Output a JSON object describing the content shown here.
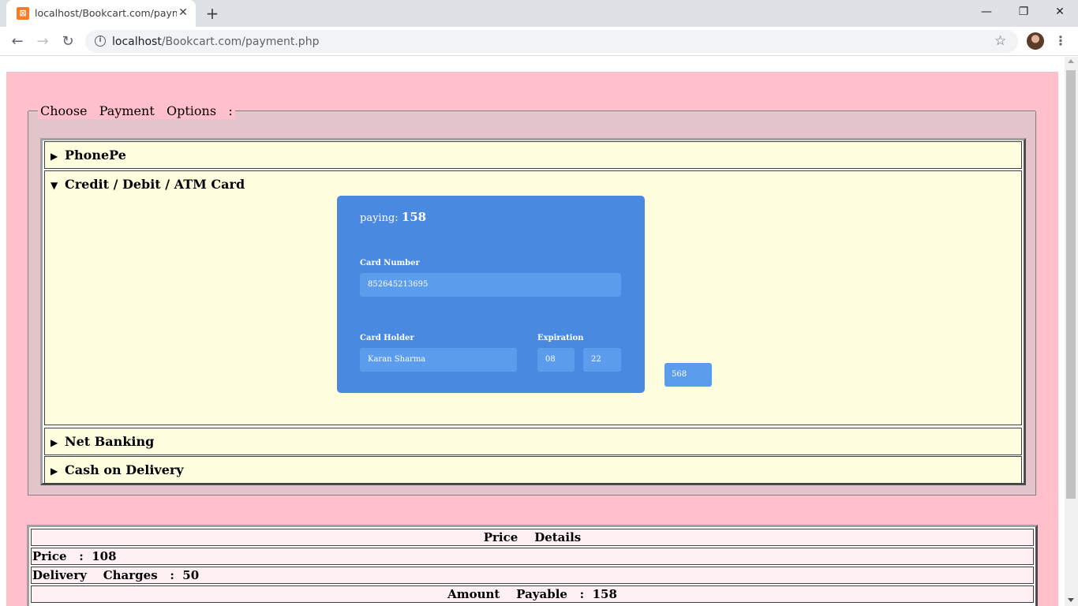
{
  "browser": {
    "tab_title": "localhost/Bookcart.com/payment.php",
    "tab_favicon": "xampp-icon",
    "close_tab_icon": "✕",
    "new_tab_icon": "+",
    "window_controls": {
      "minimize": "—",
      "restore": "❐",
      "close": "✕"
    },
    "nav": {
      "back": "←",
      "forward": "→",
      "reload": "↻"
    },
    "url_host": "localhost",
    "url_path": "/Bookcart.com/payment.php",
    "star_icon": "☆",
    "menu_icon": "⋮"
  },
  "payment": {
    "legend": "Choose   Payment   Options   :",
    "sections": [
      {
        "label": "PhonePe",
        "expanded": false,
        "marker": "▶"
      },
      {
        "label": "Credit / Debit / ATM Card",
        "expanded": true,
        "marker": "▼"
      },
      {
        "label": "Net Banking",
        "expanded": false,
        "marker": "▶"
      },
      {
        "label": "Cash on Delivery",
        "expanded": false,
        "marker": "▶"
      }
    ],
    "card": {
      "paying_label": "paying:",
      "paying_amount": "158",
      "card_number_label": "Card Number",
      "card_number_value": "852645213695",
      "card_holder_label": "Card Holder",
      "card_holder_value": "Karan Sharma",
      "expiration_label": "Expiration",
      "exp_month": "08",
      "exp_year": "22",
      "cvv_value": "568"
    },
    "colors": {
      "page_bg": "#ffc0cb",
      "accordion_bg": "#ffffe0",
      "card_bg": "#4a89e0",
      "field_bg": "#5b9cec"
    }
  },
  "price_details": {
    "title": "Price    Details",
    "price": "Price   :  108",
    "delivery": "Delivery    Charges   :  50",
    "amount": "Amount    Payable   :  158"
  }
}
